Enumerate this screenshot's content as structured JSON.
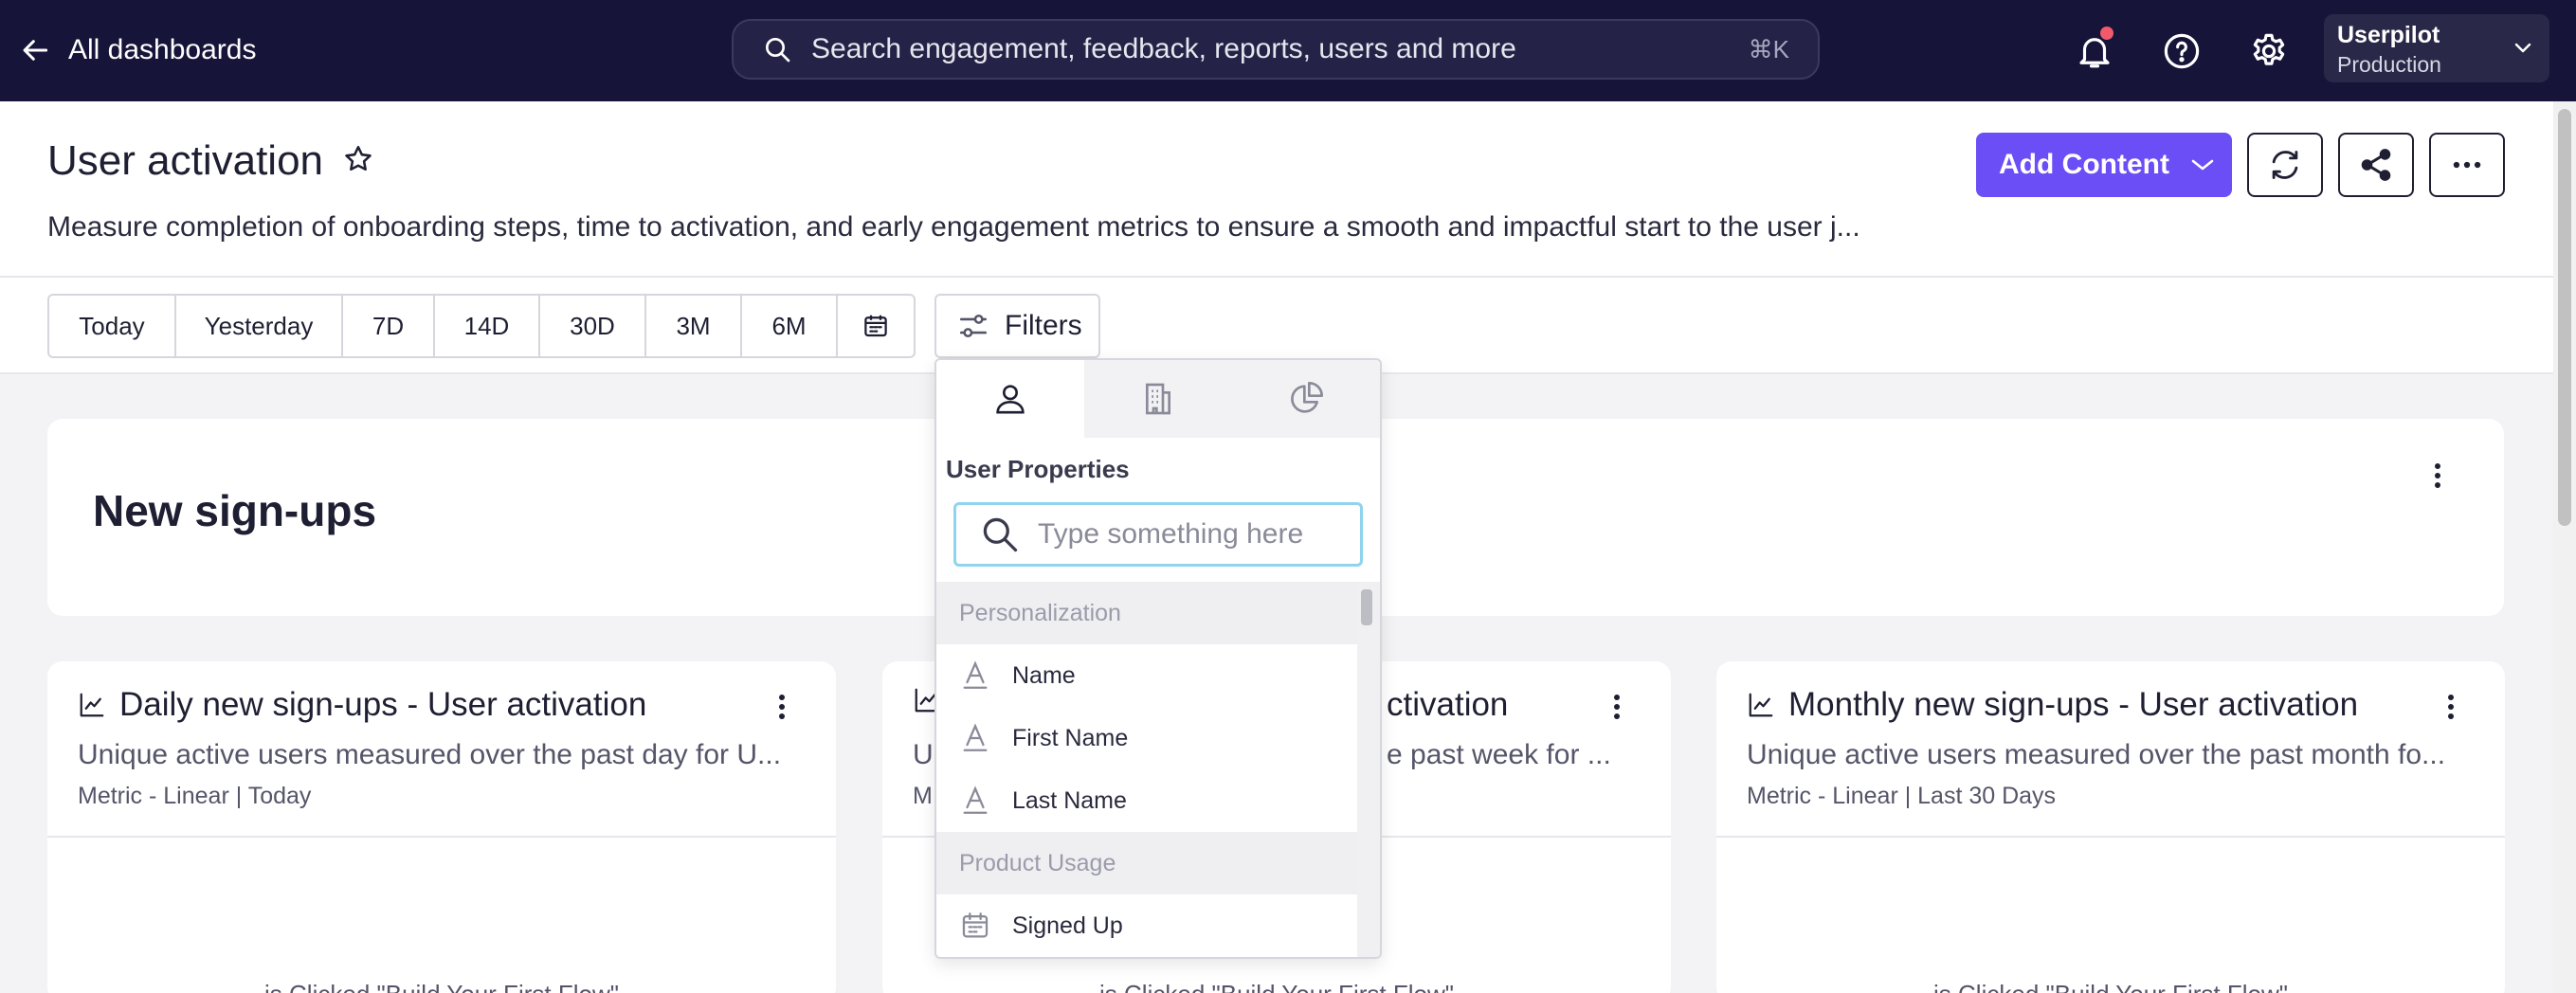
{
  "topbar": {
    "back_label": "All dashboards",
    "search_placeholder": "Search engagement, feedback, reports, users and more",
    "search_shortcut": "⌘K",
    "account_name": "Userpilot",
    "account_env": "Production",
    "bg_color": "#161438",
    "notification_dot_color": "#f05a6a"
  },
  "header": {
    "title": "User activation",
    "description": "Measure completion of onboarding steps, time to activation, and early engagement metrics to ensure a smooth and impactful start to the user j...",
    "add_content_label": "Add Content",
    "accent_color": "#6b4ef5"
  },
  "date_ranges": [
    "Today",
    "Yesterday",
    "7D",
    "14D",
    "30D",
    "3M",
    "6M"
  ],
  "filters_label": "Filters",
  "section": {
    "title": "New sign-ups"
  },
  "cards": [
    {
      "title": "Daily new sign-ups - User activation",
      "subtitle": "Unique active users measured over the past day for U...",
      "meta": "Metric - Linear | Today",
      "chart_text": "is Clicked \"Build Your First Flow\""
    },
    {
      "title": "ctivation",
      "subtitle": "Ui",
      "subtitle_tail": "e past week for ...",
      "meta": "M",
      "chart_text": "is Clicked \"Build Your First Flow\""
    },
    {
      "title": "Monthly new sign-ups - User activation",
      "subtitle": "Unique active users measured over the past month fo...",
      "meta": "Metric - Linear | Last 30 Days",
      "chart_text": "is Clicked \"Build Your First Flow\""
    }
  ],
  "dropdown": {
    "tabs": [
      "user-icon",
      "company-icon",
      "segment-icon"
    ],
    "heading": "User Properties",
    "search_placeholder": "Type something here",
    "groups": [
      {
        "label": "Personalization",
        "items": [
          "Name",
          "First Name",
          "Last Name"
        ]
      },
      {
        "label": "Product Usage",
        "items": [
          "Signed Up"
        ]
      }
    ]
  }
}
